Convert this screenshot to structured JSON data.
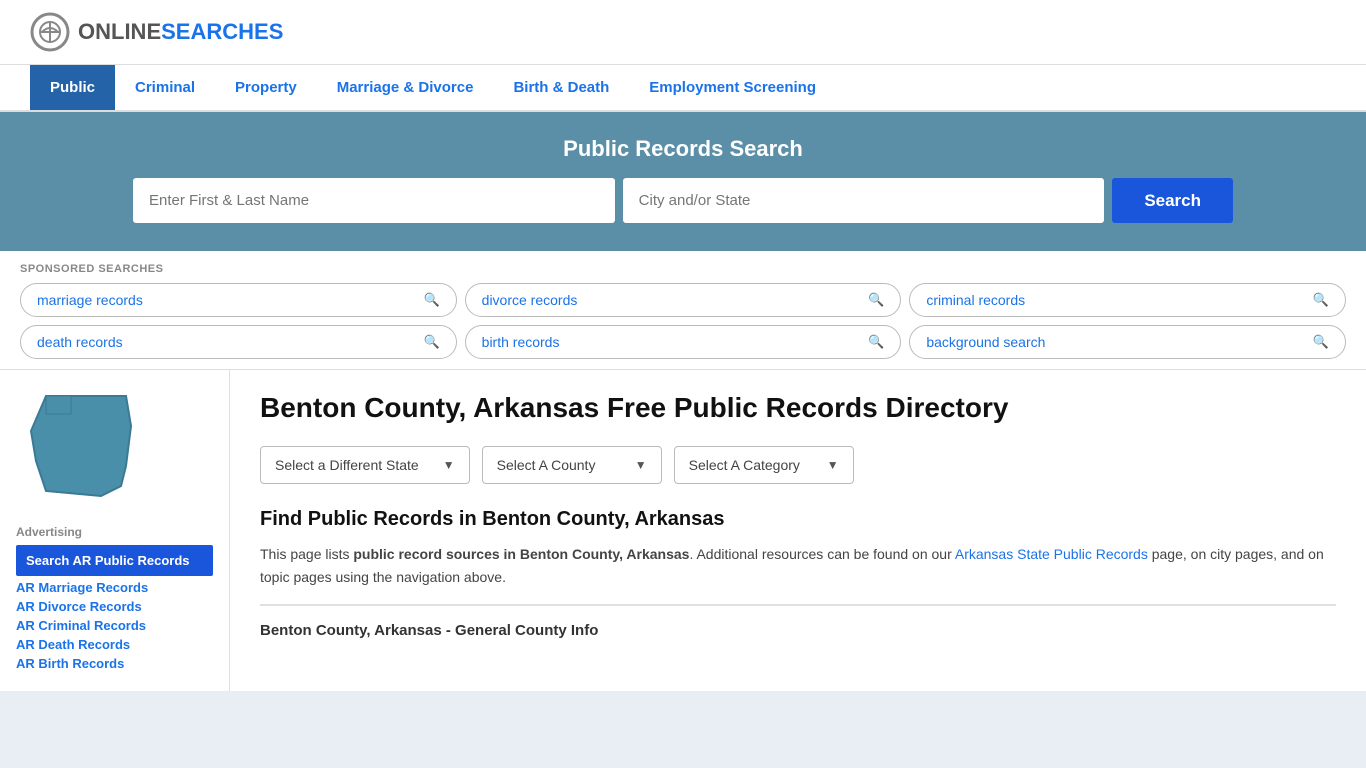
{
  "logo": {
    "text_online": "ONLINE",
    "text_searches": "SEARCHES",
    "icon_label": "logo-icon"
  },
  "nav": {
    "items": [
      {
        "label": "Public",
        "active": true
      },
      {
        "label": "Criminal",
        "active": false
      },
      {
        "label": "Property",
        "active": false
      },
      {
        "label": "Marriage & Divorce",
        "active": false
      },
      {
        "label": "Birth & Death",
        "active": false
      },
      {
        "label": "Employment Screening",
        "active": false
      }
    ]
  },
  "search_banner": {
    "title": "Public Records Search",
    "name_placeholder": "Enter First & Last Name",
    "city_placeholder": "City and/or State",
    "button_label": "Search"
  },
  "sponsored": {
    "label": "SPONSORED SEARCHES",
    "pills": [
      {
        "label": "marriage records"
      },
      {
        "label": "divorce records"
      },
      {
        "label": "criminal records"
      },
      {
        "label": "death records"
      },
      {
        "label": "birth records"
      },
      {
        "label": "background search"
      }
    ]
  },
  "sidebar": {
    "advertising_label": "Advertising",
    "ad_item_label": "Search AR Public Records",
    "links": [
      {
        "label": "AR Marriage Records"
      },
      {
        "label": "AR Divorce Records"
      },
      {
        "label": "AR Criminal Records"
      },
      {
        "label": "AR Death Records"
      },
      {
        "label": "AR Birth Records"
      }
    ]
  },
  "main": {
    "page_title": "Benton County, Arkansas Free Public Records Directory",
    "dropdowns": [
      {
        "label": "Select a Different State"
      },
      {
        "label": "Select A County"
      },
      {
        "label": "Select A Category"
      }
    ],
    "section_heading": "Find Public Records in Benton County, Arkansas",
    "description_1": "This page lists ",
    "description_bold": "public record sources in Benton County, Arkansas",
    "description_2": ". Additional resources can be found on our ",
    "link_text": "Arkansas State Public Records",
    "description_3": " page, on city pages, and on topic pages using the navigation above.",
    "general_info_heading": "Benton County, Arkansas - General County Info"
  }
}
